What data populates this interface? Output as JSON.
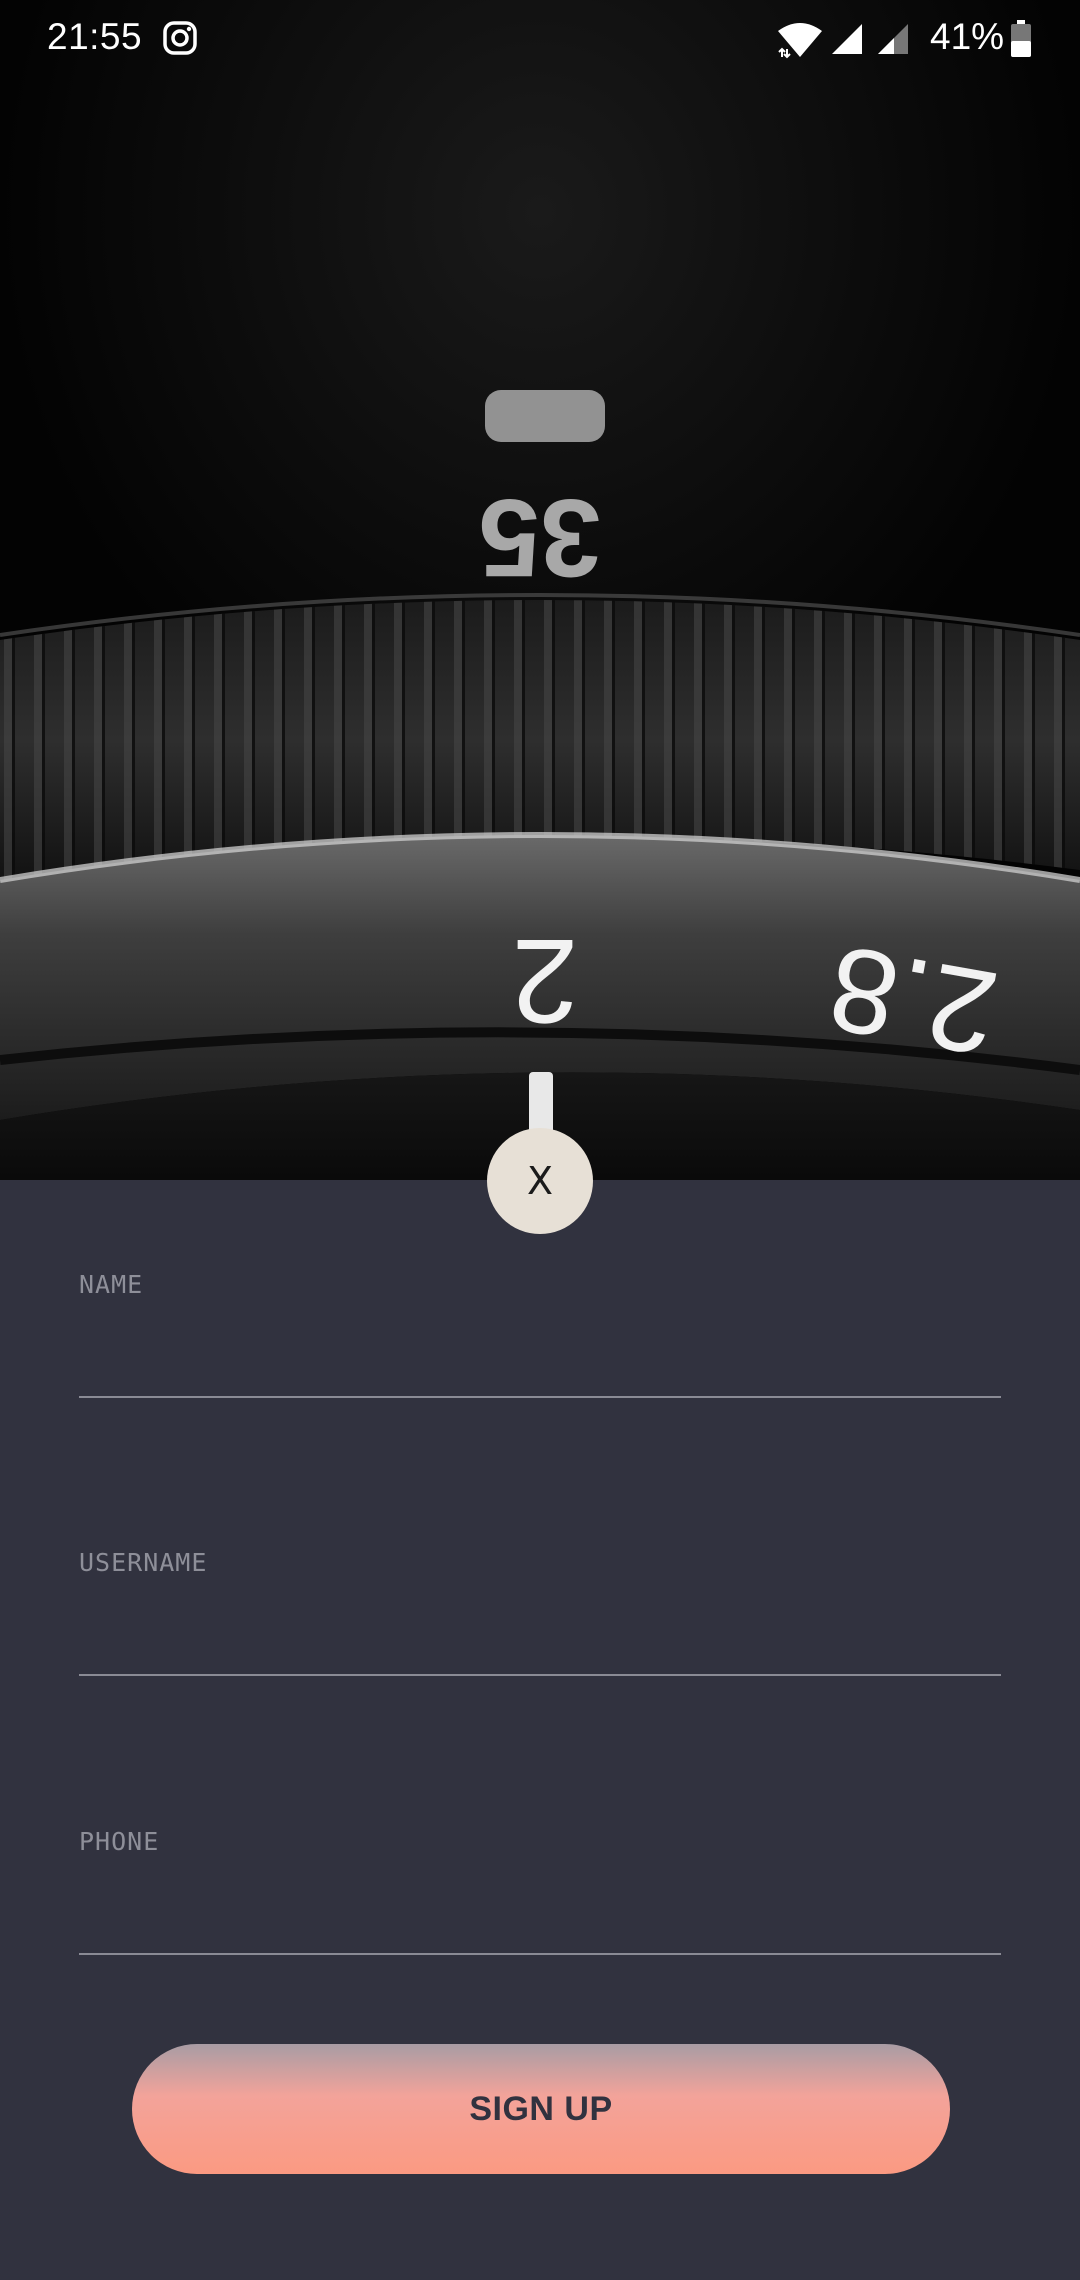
{
  "status_bar": {
    "time": "21:55",
    "battery": "41%",
    "icons": [
      "instagram-icon",
      "wifi-icon",
      "cell-signal-icon",
      "cell-signal-weak-icon",
      "battery-icon"
    ]
  },
  "hero": {
    "lens_markings": [
      "35",
      "2",
      "2.8"
    ]
  },
  "close_button": {
    "label": "X"
  },
  "form": {
    "name_label": "NAME",
    "name_value": "",
    "username_label": "USERNAME",
    "username_value": "",
    "phone_label": "PHONE",
    "phone_value": ""
  },
  "signup_button": {
    "label": "SIGN UP"
  },
  "colors": {
    "background": "#31323f",
    "button_gradient_top": "#a89ca4",
    "button_gradient_bottom": "#fb9a82",
    "close_button_bg": "#e7e0d6"
  }
}
